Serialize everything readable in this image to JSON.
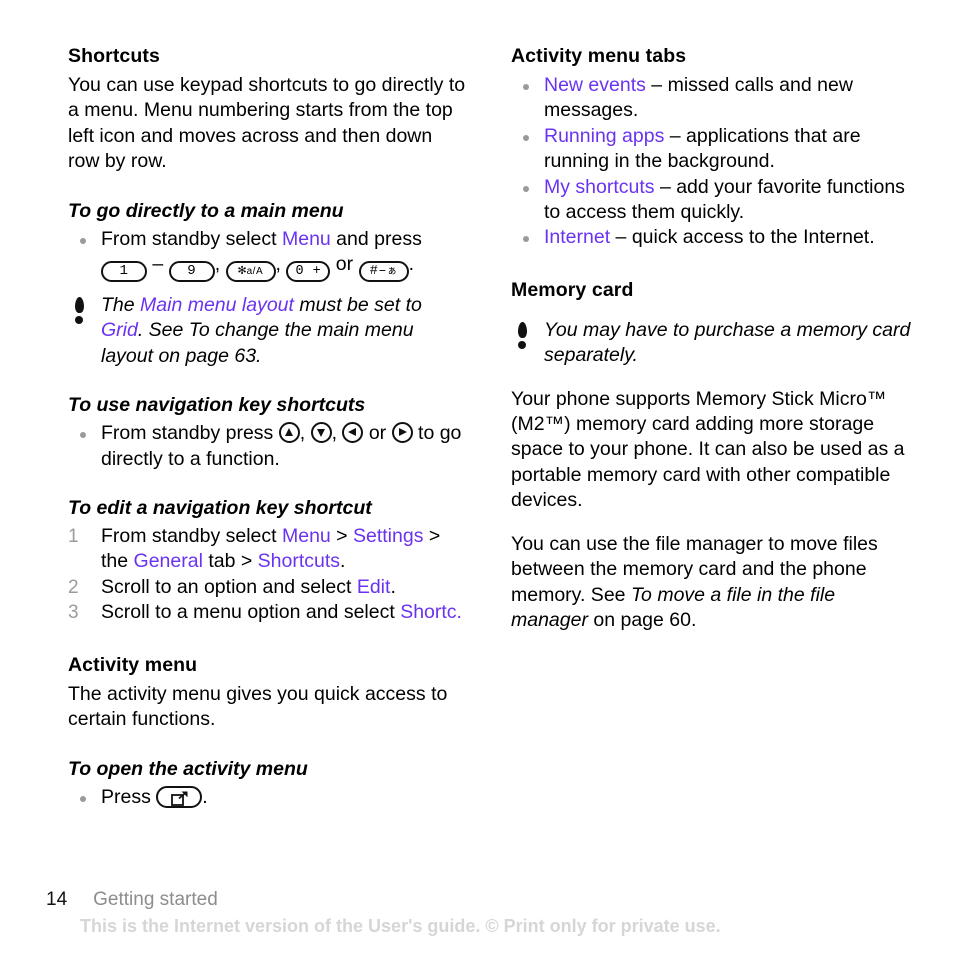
{
  "document": {
    "page_number": "14",
    "chapter": "Getting started",
    "watermark": "This is the Internet version of the User's guide. © Print only for private use."
  },
  "left_column": {
    "shortcuts": {
      "heading": "Shortcuts",
      "intro": "You can use keypad shortcuts to go directly to a menu. Menu numbering starts from the top left icon and moves across and then down row by row.",
      "proc_main_menu": {
        "title": "To go directly to a main menu",
        "step_prefix": "From standby select ",
        "link_menu": "Menu",
        "step_mid": " and press ",
        "key_1": "1",
        "dash": "–",
        "key_9": "9",
        "comma1": ", ",
        "key_star": "✻",
        "key_star_sup": "a/A",
        "comma2": ", ",
        "key_zero": "0 +",
        "or": " or ",
        "key_hash": "#",
        "key_hash_sub": "ぁ",
        "period": "."
      },
      "note": {
        "text_1": "The ",
        "link_1": "Main menu layout",
        "text_2": " must be set to ",
        "link_2": "Grid",
        "text_3": ". See To change the main menu layout on page 63."
      },
      "proc_nav_keys": {
        "title": "To use navigation key shortcuts",
        "text_1": "From standby press ",
        "sep_1": ", ",
        "sep_2": ", ",
        "sep_3": " or ",
        "text_2": " to go directly to a function."
      },
      "proc_edit_nav": {
        "title": "To edit a navigation key shortcut",
        "steps": [
          {
            "num": "1",
            "t1": "From standby select ",
            "l1": "Menu",
            "t2": " > ",
            "l2": "Settings",
            "t3": " > the ",
            "l3": "General",
            "t4": " tab > ",
            "l4": "Shortcuts",
            "t5": "."
          },
          {
            "num": "2",
            "t1": "Scroll to an option and select ",
            "l1": "Edit",
            "t2": "."
          },
          {
            "num": "3",
            "t1": "Scroll to a menu option and select ",
            "l1": "Shortc.",
            "t2": ""
          }
        ]
      }
    },
    "activity_menu": {
      "heading": "Activity menu",
      "intro": "The activity menu gives you quick access to certain functions.",
      "proc_open": {
        "title": "To open the activity menu",
        "text_1": "Press ",
        "text_2": "."
      }
    }
  },
  "right_column": {
    "activity_menu_tabs": {
      "heading": "Activity menu tabs",
      "items": [
        {
          "link": "New events",
          "text": " – missed calls and new messages."
        },
        {
          "link": "Running apps",
          "text": " – applications that are running in the background."
        },
        {
          "link": "My shortcuts",
          "text": " – add your favorite functions to access them quickly."
        },
        {
          "link": "Internet",
          "text": " – quick access to the Internet."
        }
      ]
    },
    "memory_card": {
      "heading": "Memory card",
      "note": "You may have to purchase a memory card separately.",
      "para_1": "Your phone supports Memory Stick Micro™ (M2™) memory card adding more storage space to your phone. It can also be used as a portable memory card with other compatible devices.",
      "para_2": {
        "t1": "You can use the file manager to move files between the memory card and the phone memory. See ",
        "italic": "To move a file in the file manager",
        "t2": " on page 60."
      }
    }
  },
  "colors": {
    "link": "#6a33f0",
    "bullet": "#9a9a9a",
    "step_number": "#9b9b9b",
    "chapter": "#8d8d8d",
    "watermark": "#d6d6d6"
  }
}
